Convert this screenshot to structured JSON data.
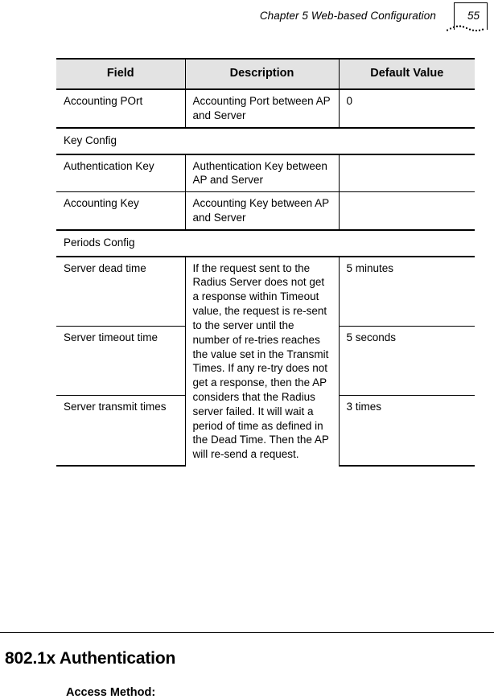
{
  "header": {
    "title": "Chapter 5 Web-based Configuration",
    "page_number": "55",
    "flourish_icon": "dotted-arc-icon"
  },
  "table": {
    "columns": [
      "Field",
      "Description",
      "Default Value"
    ],
    "rows": [
      {
        "type": "data",
        "field": "Accounting POrt",
        "description": "Accounting Port between AP and Server",
        "default": "0"
      },
      {
        "type": "section",
        "label": "Key Config"
      },
      {
        "type": "data",
        "field": "Authentication Key",
        "description": "Authentication Key between AP and Server",
        "default": ""
      },
      {
        "type": "data",
        "field": "Accounting Key",
        "description": "Accounting Key between AP and Server",
        "default": ""
      },
      {
        "type": "section",
        "label": "Periods Config"
      },
      {
        "type": "data",
        "field": "Server dead time",
        "description": "",
        "default": "5 minutes"
      },
      {
        "type": "data",
        "field": "Server timeout time",
        "description": "",
        "default": "5 seconds"
      },
      {
        "type": "data",
        "field": "Server transmit times",
        "description": "",
        "default": "3 times"
      }
    ],
    "merged_description": "If the request sent to the Radius Server does not get a response within Timeout value, the request is re-sent to the server until the number of re-tries reaches the value set in the Transmit Times. If any re-try does not get a response, then the AP considers that the Radius server failed. It will wait a period of time as defined in the Dead Time. Then the AP will re-send a request."
  },
  "body": {
    "section_heading": "802.1x Authentication",
    "sub_heading": "Access Method:"
  }
}
